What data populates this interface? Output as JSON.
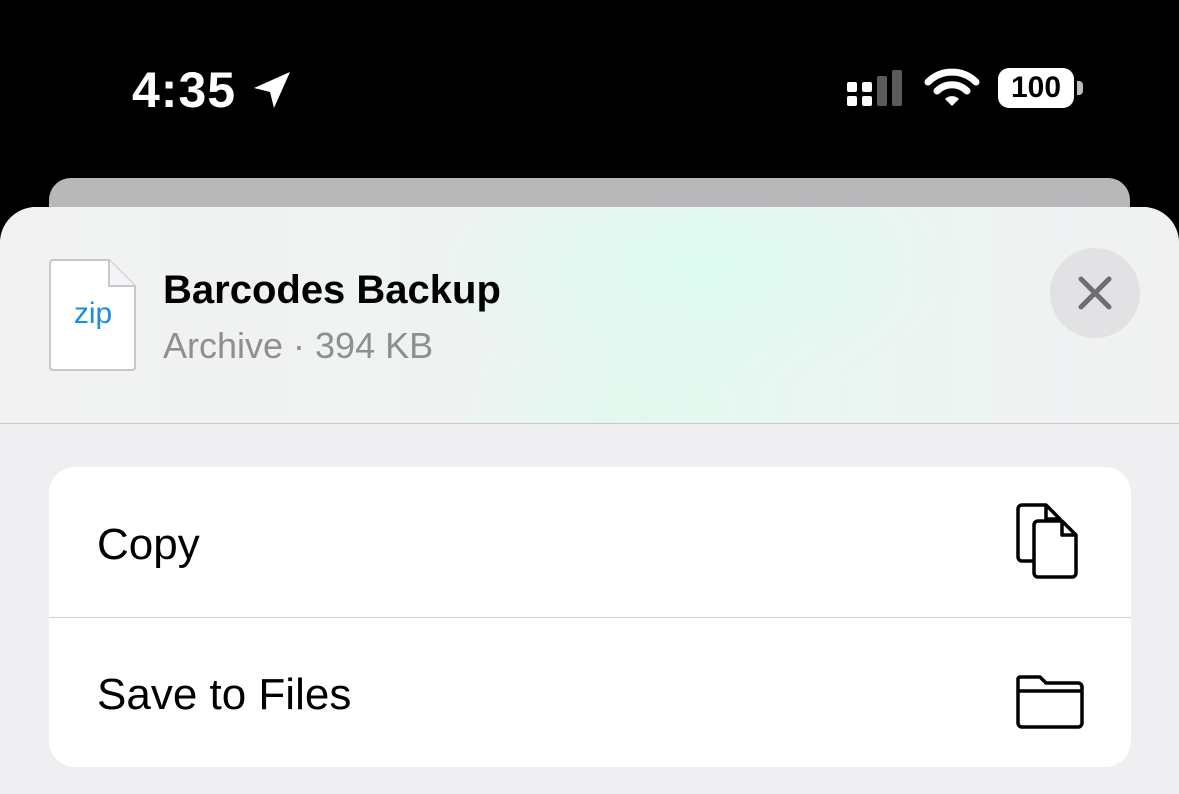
{
  "status_bar": {
    "time": "4:35",
    "location_icon": "location-arrow-icon",
    "signal_icon": "cellular-signal-icon",
    "wifi_icon": "wifi-icon",
    "battery_level": "100"
  },
  "share_sheet": {
    "file": {
      "icon_label": "zip",
      "title": "Barcodes Backup",
      "subtitle": "Archive · 394 KB"
    },
    "close_icon": "close-icon",
    "actions": [
      {
        "label": "Copy",
        "icon": "copy-icon"
      },
      {
        "label": "Save to Files",
        "icon": "folder-icon"
      }
    ]
  },
  "colors": {
    "accent_zip": "#1A8FE0",
    "secondary_text": "#8E8E93",
    "sheet_background": "#EFEFF1"
  }
}
